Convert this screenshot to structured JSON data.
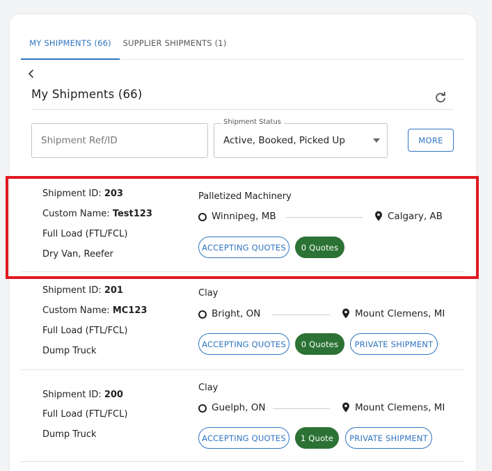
{
  "tabs": [
    {
      "label": "MY SHIPMENTS (66)",
      "active": true
    },
    {
      "label": "SUPPLIER SHIPMENTS (1)",
      "active": false
    }
  ],
  "page": {
    "title": "My Shipments (66)"
  },
  "filters": {
    "ref_placeholder": "Shipment Ref/ID",
    "status_legend": "Shipment Status",
    "status_value": "Active, Booked, Picked Up",
    "more_label": "MORE"
  },
  "labels": {
    "shipment_id": "Shipment ID: ",
    "custom_name": "Custom Name: "
  },
  "shipments": [
    {
      "id": "203",
      "custom_name": "Test123",
      "load": "Full Load (FTL/FCL)",
      "equipment": "Dry Van, Reefer",
      "cargo": "Palletized Machinery",
      "origin": "Winnipeg, MB",
      "destination": "Calgary, AB",
      "chips": [
        "ACCEPTING QUOTES",
        "0 Quotes"
      ]
    },
    {
      "id": "201",
      "custom_name": "MC123",
      "load": "Full Load (FTL/FCL)",
      "equipment": "Dump Truck",
      "cargo": "Clay",
      "origin": "Bright, ON",
      "destination": "Mount Clemens, MI",
      "chips": [
        "ACCEPTING QUOTES",
        "0 Quotes",
        "PRIVATE SHIPMENT"
      ]
    },
    {
      "id": "200",
      "load": "Full Load (FTL/FCL)",
      "equipment": "Dump Truck",
      "cargo": "Clay",
      "origin": "Guelph, ON",
      "destination": "Mount Clemens, MI",
      "chips": [
        "ACCEPTING QUOTES",
        "1 Quote",
        "PRIVATE SHIPMENT"
      ]
    }
  ],
  "icons": {
    "back": "chevron-left-icon",
    "refresh": "refresh-icon",
    "origin": "circle-outline-icon",
    "destination": "map-pin-icon",
    "dropdown": "caret-down-icon"
  },
  "colors": {
    "accent": "#2f74c0",
    "quote_chip": "#2b7234",
    "highlight": "#e0191f"
  }
}
